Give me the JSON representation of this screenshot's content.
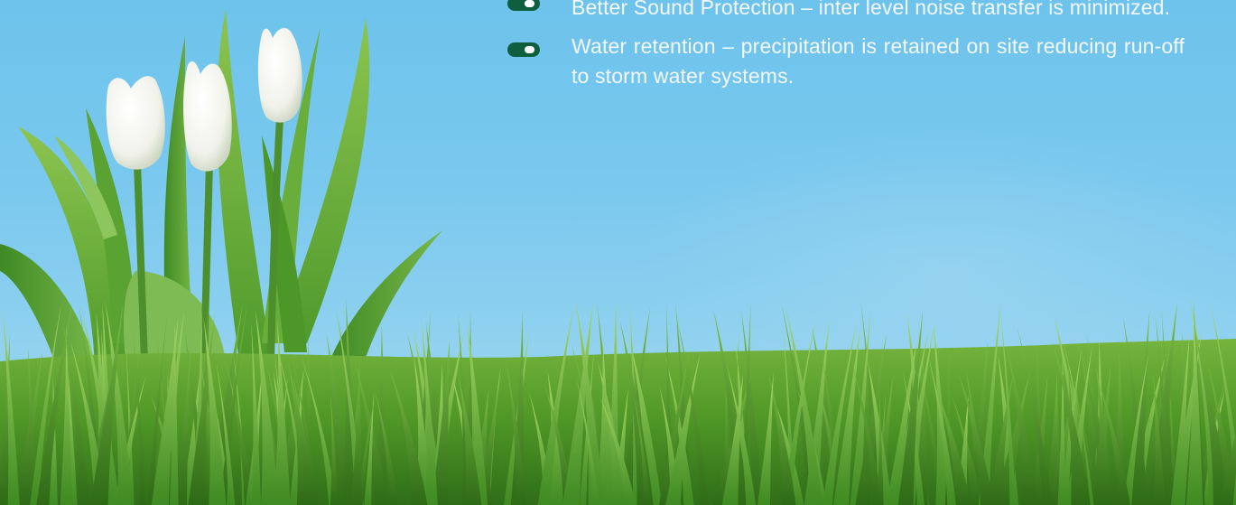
{
  "bullets": [
    {
      "text": "Better Sound Protection – inter level noise transfer is minimized."
    },
    {
      "text": "Water retention – precipitation is retained on site reducing run-off to storm water systems."
    }
  ],
  "colors": {
    "sky": "#79c8ee",
    "bullet_marker": "#0e5f3e",
    "text": "#f4f8fb",
    "grass": "#5ea52e",
    "tulip": "#f7f7f2"
  },
  "image": {
    "subject": "white-tulips-and-green-grass-photo"
  }
}
